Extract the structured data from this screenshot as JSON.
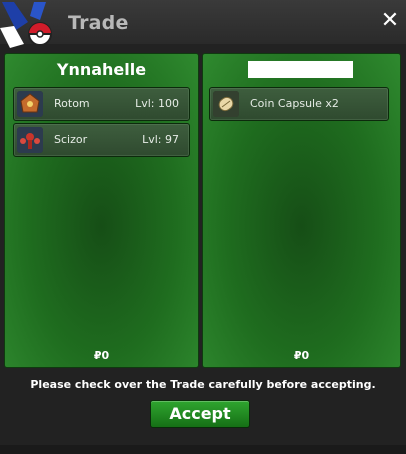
{
  "window": {
    "title": "Trade",
    "close_glyph": "✕"
  },
  "left_panel": {
    "player_name": "Ynnahelle",
    "items": [
      {
        "name": "Rotom",
        "level": "Lvl: 100",
        "icon": "rotom-icon"
      },
      {
        "name": "Scizor",
        "level": "Lvl: 97",
        "icon": "scizor-icon"
      }
    ],
    "money": "₽0"
  },
  "right_panel": {
    "player_name_redacted": true,
    "items": [
      {
        "name": "Coin Capsule  x2",
        "icon": "coin-capsule-icon"
      }
    ],
    "money": "₽0"
  },
  "footer": {
    "notice": "Please check over the Trade carefully before accepting.",
    "accept_label": "Accept"
  },
  "colors": {
    "panel_green": "#1f6d1f",
    "accept_green": "#2fa52f",
    "titlebar": "#2e2e2e"
  }
}
